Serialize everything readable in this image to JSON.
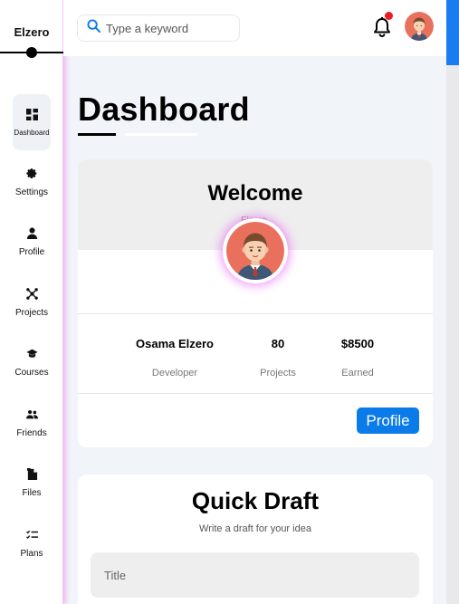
{
  "brand": "Elzero",
  "sidebar": {
    "items": [
      {
        "label": "Dashboard",
        "icon": "grid-icon",
        "active": true
      },
      {
        "label": "Settings",
        "icon": "gear-icon"
      },
      {
        "label": "Profile",
        "icon": "user-icon"
      },
      {
        "label": "Projects",
        "icon": "diagram-icon"
      },
      {
        "label": "Courses",
        "icon": "graduation-cap-icon"
      },
      {
        "label": "Friends",
        "icon": "users-icon"
      },
      {
        "label": "Files",
        "icon": "file-icon"
      },
      {
        "label": "Plans",
        "icon": "checklist-icon"
      }
    ]
  },
  "header": {
    "search_placeholder": "Type a keyword",
    "notification_dot_color": "#ee1b24"
  },
  "page": {
    "title": "Dashboard"
  },
  "welcome": {
    "title": "Welcome",
    "subtitle": "Elzero",
    "name": "Osama Elzero",
    "role": "Developer",
    "projects_value": "80",
    "projects_label": "Projects",
    "earned_value": "$8500",
    "earned_label": "Earned",
    "button_label": "Profile"
  },
  "draft": {
    "title": "Quick Draft",
    "subtitle": "Write a draft for your idea",
    "title_placeholder": "Title"
  },
  "colors": {
    "accent": "#0b7bea",
    "sidebar_glow": "#e65af0"
  }
}
